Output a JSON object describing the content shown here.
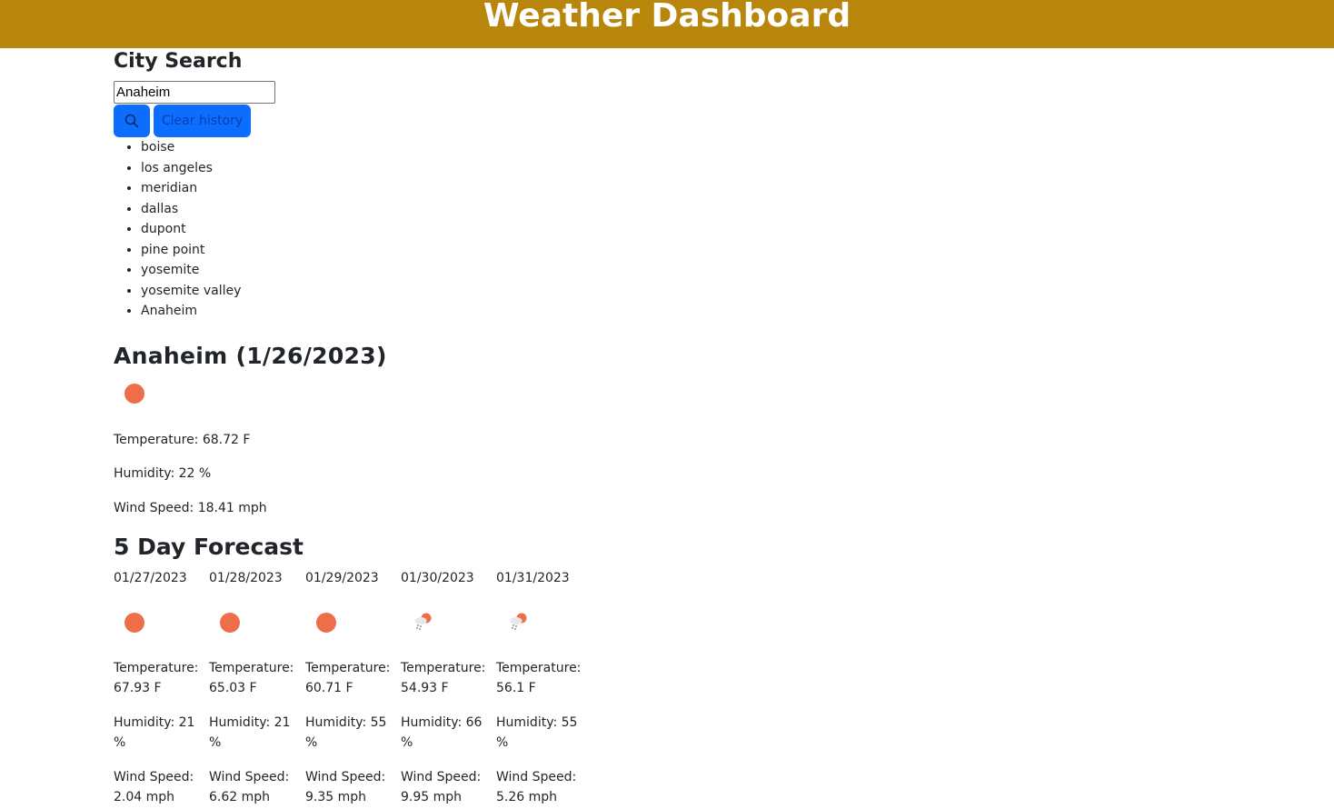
{
  "header": {
    "title": "Weather Dashboard"
  },
  "search": {
    "title": "City Search",
    "input_value": "Anaheim",
    "clear_label": "Clear history"
  },
  "history": [
    "boise",
    "los angeles",
    "meridian",
    "dallas",
    "dupont",
    "pine point",
    "yosemite",
    "yosemite valley",
    "Anaheim"
  ],
  "current": {
    "title": "Anaheim (1/26/2023)",
    "icon": "sun-icon",
    "temperature": "Temperature: 68.72 F",
    "humidity": "Humidity: 22 %",
    "wind": "Wind Speed: 18.41 mph"
  },
  "forecast": {
    "title": "5 Day Forecast",
    "days": [
      {
        "date": "01/27/2023",
        "icon": "sun-icon",
        "temp_label": "Temperature:",
        "temp_value": "67.93 F",
        "hum_label": "Humidity: 21",
        "hum_unit": "%",
        "wind_label": "Wind Speed:",
        "wind_value": "2.04 mph"
      },
      {
        "date": "01/28/2023",
        "icon": "sun-icon",
        "temp_label": "Temperature:",
        "temp_value": "65.03 F",
        "hum_label": "Humidity: 21",
        "hum_unit": "%",
        "wind_label": "Wind Speed:",
        "wind_value": "6.62 mph"
      },
      {
        "date": "01/29/2023",
        "icon": "sun-icon",
        "temp_label": "Temperature:",
        "temp_value": "60.71 F",
        "hum_label": "Humidity: 55",
        "hum_unit": "%",
        "wind_label": "Wind Speed:",
        "wind_value": "9.35 mph"
      },
      {
        "date": "01/30/2023",
        "icon": "rain-sun-icon",
        "temp_label": "Temperature:",
        "temp_value": "54.93 F",
        "hum_label": "Humidity: 66",
        "hum_unit": "%",
        "wind_label": "Wind Speed:",
        "wind_value": "9.95 mph"
      },
      {
        "date": "01/31/2023",
        "icon": "rain-sun-icon",
        "temp_label": "Temperature:",
        "temp_value": "56.1 F",
        "hum_label": "Humidity: 55",
        "hum_unit": "%",
        "wind_label": "Wind Speed:",
        "wind_value": "5.26 mph"
      }
    ]
  },
  "colors": {
    "header_bg": "#b8860b",
    "button_bg": "#0d6efd",
    "sun": "#ee6e4a"
  }
}
